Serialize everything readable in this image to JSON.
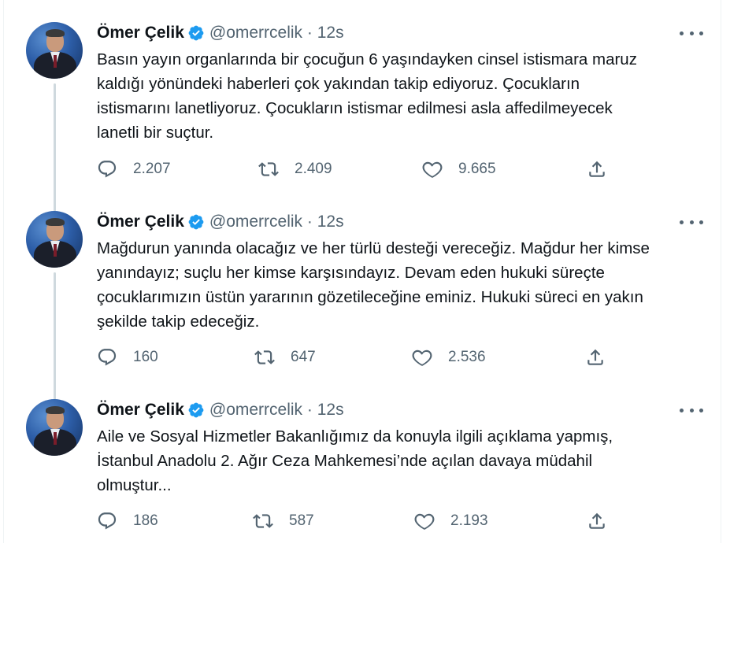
{
  "tweets": [
    {
      "name": "Ömer Çelik",
      "handle": "@omerrcelik · 12s",
      "lines": [
        "Basın yayın organlarında bir çocuğun 6 yaşındayken cinsel istismara maruz",
        "kaldığı yönündeki haberleri çok yakından takip ediyoruz. Çocukların",
        "istismarını lanetliyoruz. Çocukların istismar edilmesi asla affedilmeyecek",
        "lanetli bir suçtur."
      ],
      "replies": "2.207",
      "retweets": "2.409",
      "likes": "9.665"
    },
    {
      "name": "Ömer Çelik",
      "handle": "@omerrcelik · 12s",
      "lines": [
        "Mağdurun yanında olacağız ve her türlü desteği vereceğiz. Mağdur her kimse",
        "yanındayız;  suçlu her kimse karşısındayız. Devam eden hukuki süreçte",
        "çocuklarımızın üstün yararının gözetileceğine eminiz. Hukuki süreci en yakın",
        "şekilde takip edeceğiz."
      ],
      "replies": "160",
      "retweets": "647",
      "likes": "2.536"
    },
    {
      "name": "Ömer Çelik",
      "handle": "@omerrcelik · 12s",
      "lines": [
        "Aile ve Sosyal Hizmetler Bakanlığımız da konuyla ilgili açıklama yapmış,",
        "İstanbul Anadolu 2. Ağır Ceza Mahkemesi’nde açılan davaya müdahil",
        "olmuştur..."
      ],
      "replies": "186",
      "retweets": "587",
      "likes": "2.193"
    }
  ],
  "icons": {
    "verified": "verified-badge-icon",
    "more": "more-dots-icon",
    "reply": "reply-icon",
    "retweet": "retweet-icon",
    "like": "like-icon",
    "share": "share-icon"
  },
  "colors": {
    "verified": "#1d9bf0",
    "text": "#0f1419",
    "muted": "#536471",
    "connector": "#cfd9de"
  }
}
